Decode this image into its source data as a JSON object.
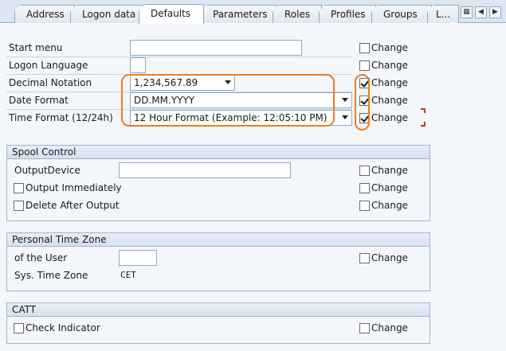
{
  "tabs": [
    {
      "label": "Address"
    },
    {
      "label": "Logon data"
    },
    {
      "label": "Defaults"
    },
    {
      "label": "Parameters"
    },
    {
      "label": "Roles"
    },
    {
      "label": "Profiles"
    },
    {
      "label": "Groups"
    },
    {
      "label": "L..."
    }
  ],
  "defaults": {
    "start_menu": {
      "label": "Start menu",
      "value": ""
    },
    "logon_language": {
      "label": "Logon Language",
      "value": ""
    },
    "decimal_notation": {
      "label": "Decimal Notation",
      "value": "1,234,567.89"
    },
    "date_format": {
      "label": "Date Format",
      "value": "DD.MM.YYYY"
    },
    "time_format": {
      "label": "Time Format (12/24h)",
      "value": "12 Hour Format (Example: 12:05:10 PM)"
    },
    "change_label": "Change"
  },
  "spool": {
    "title": "Spool Control",
    "output_device": {
      "label": "OutputDevice",
      "value": ""
    },
    "output_immediately": {
      "label": "Output Immediately"
    },
    "delete_after_output": {
      "label": "Delete After Output"
    }
  },
  "timezone": {
    "title": "Personal Time Zone",
    "of_user": {
      "label": "of the User",
      "value": ""
    },
    "sys_tz": {
      "label": "Sys. Time Zone",
      "value": "CET"
    }
  },
  "catt": {
    "title": "CATT",
    "check_indicator": {
      "label": "Check Indicator"
    }
  },
  "colors": {
    "highlight": "#f07c1e",
    "accent": "#8fa9c8"
  }
}
